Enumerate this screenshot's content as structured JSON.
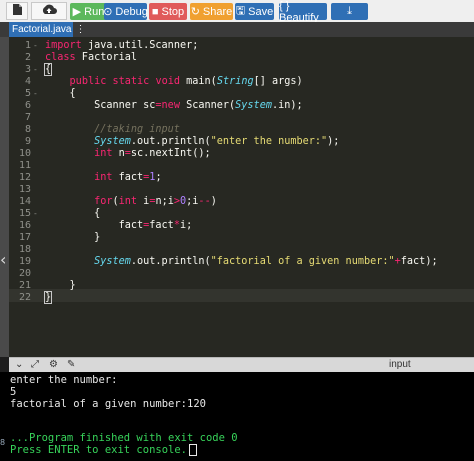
{
  "toolbar": {
    "run_label": "Run",
    "debug_label": "Debug",
    "stop_label": "Stop",
    "share_label": "Share",
    "save_label": "Save",
    "beautify_label": "{ } Beautify",
    "icons": [
      "file-icon",
      "upload-icon",
      "download-icon"
    ],
    "colors": {
      "run": "#5cb85c",
      "debug": "#2f6fb5",
      "stop": "#e05a5a",
      "share": "#f0a030",
      "save": "#2f6fb5",
      "beautify": "#2f6fb5",
      "download": "#2f6fb5"
    }
  },
  "tab": {
    "filename": "Factorial.java",
    "menu_glyph": "⋮"
  },
  "editor": {
    "line_numbers": [
      "1",
      "2",
      "3",
      "4",
      "5",
      "6",
      "7",
      "8",
      "9",
      "10",
      "11",
      "12",
      "13",
      "14",
      "15",
      "16",
      "17",
      "18",
      "19",
      "20",
      "21",
      "22"
    ],
    "code": [
      "import java.util.Scanner;",
      "class Factorial",
      "{",
      "    public static void main(String[] args)",
      "    {",
      "        Scanner sc=new Scanner(System.in);",
      "",
      "        //taking input",
      "        System.out.println(\"enter the number:\");",
      "        int n=sc.nextInt();",
      "",
      "        int fact=1;",
      "",
      "        for(int i=n;i>0;i--)",
      "        {",
      "            fact=fact*i;",
      "        }",
      "",
      "        System.out.println(\"factorial of a given number:\"+fact);",
      "",
      "    }",
      "}"
    ]
  },
  "console_bar": {
    "title": "input",
    "icons": [
      "chevron-down-icon",
      "expand-icon",
      "gear-icon",
      "clear-icon"
    ]
  },
  "console": {
    "lines": [
      "enter the number:",
      "5",
      "factorial of a given number:120",
      "",
      "",
      "...Program finished with exit code 0",
      "Press ENTER to exit console."
    ],
    "side_label": "8"
  }
}
